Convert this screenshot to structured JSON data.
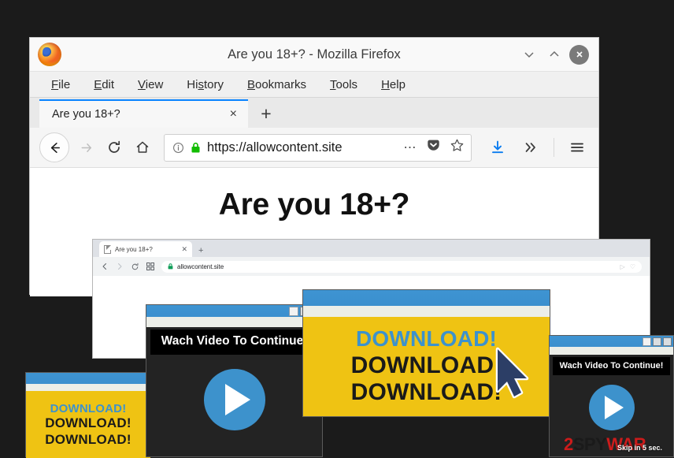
{
  "background_color": "#1b1b1b",
  "firefox_window": {
    "title": "Are you 18+? - Mozilla Firefox",
    "logo_icon": "firefox-logo",
    "window_controls": {
      "minimize": "∨",
      "maximize": "∧",
      "close": "×"
    },
    "menu_items": [
      {
        "accel": "F",
        "rest": "ile"
      },
      {
        "accel": "E",
        "rest": "dit"
      },
      {
        "accel": "V",
        "rest": "iew"
      },
      {
        "pre": "Hi",
        "accel": "s",
        "rest": "tory"
      },
      {
        "accel": "B",
        "rest": "ookmarks"
      },
      {
        "accel": "T",
        "rest": "ools"
      },
      {
        "accel": "H",
        "rest": "elp"
      }
    ],
    "tab": {
      "title": "Are you 18+?",
      "close_label": "×"
    },
    "new_tab_label": "+",
    "toolbar": {
      "back_icon": "back-arrow-icon",
      "forward_icon": "forward-arrow-icon",
      "reload_icon": "reload-icon",
      "home_icon": "home-icon",
      "identity_icon": "info-icon",
      "lock_icon": "padlock-icon",
      "url": "https://allowcontent.site",
      "page_actions_icon": "ellipsis-icon",
      "pocket_icon": "pocket-icon",
      "bookmark_icon": "star-icon",
      "downloads_icon": "download-arrow-icon",
      "overflow_icon": "chevron-double-right-icon",
      "menu_icon": "hamburger-menu-icon"
    },
    "page": {
      "heading": "Are you 18+?"
    }
  },
  "chrome_window": {
    "tab": {
      "favicon": "page-favicon",
      "title": "Are you 18+?",
      "close_label": "✕"
    },
    "new_tab_label": "+",
    "toolbar": {
      "back_icon": "back-chevron-icon",
      "forward_icon": "forward-chevron-icon",
      "reload_icon": "reload-icon",
      "apps_icon": "apps-grid-icon",
      "lock_icon": "padlock-icon",
      "url": "allowcontent.site",
      "cast_icon": "cast-icon",
      "shield_icon": "shield-icon"
    }
  },
  "popups": [
    {
      "id": "download-popup-small",
      "type": "download",
      "lines": [
        {
          "text": "DOWNLOAD!",
          "color": "blue"
        },
        {
          "text": "DOWNLOAD!",
          "color": "black"
        },
        {
          "text": "DOWNLOAD!",
          "color": "black"
        }
      ]
    },
    {
      "id": "video-popup-left",
      "type": "video",
      "caption": "Wach Video To Continue!",
      "play_icon": "play-button-icon"
    },
    {
      "id": "download-popup-large",
      "type": "download",
      "lines": [
        {
          "text": "DOWNLOAD!",
          "color": "blue"
        },
        {
          "text": "DOWNLOAD!",
          "color": "black"
        },
        {
          "text": "DOWNLOAD!",
          "color": "black"
        }
      ],
      "cursor_icon": "mouse-cursor-arrow-icon"
    },
    {
      "id": "video-popup-right",
      "type": "video",
      "caption": "Wach Video To Continue!",
      "play_icon": "play-button-icon"
    }
  ],
  "watermark": {
    "part1": "2",
    "part2": "SPY",
    "part3": "WAR",
    "skip_text": "Skip in 5 sec."
  },
  "colors": {
    "popup_titlebar_blue": "#3d92cc",
    "download_yellow": "#efc313",
    "play_blue": "#3d92cc",
    "lock_green": "#12bc00",
    "firefox_tab_accent": "#0a84ff",
    "watermark_red": "#cc1b1b"
  }
}
